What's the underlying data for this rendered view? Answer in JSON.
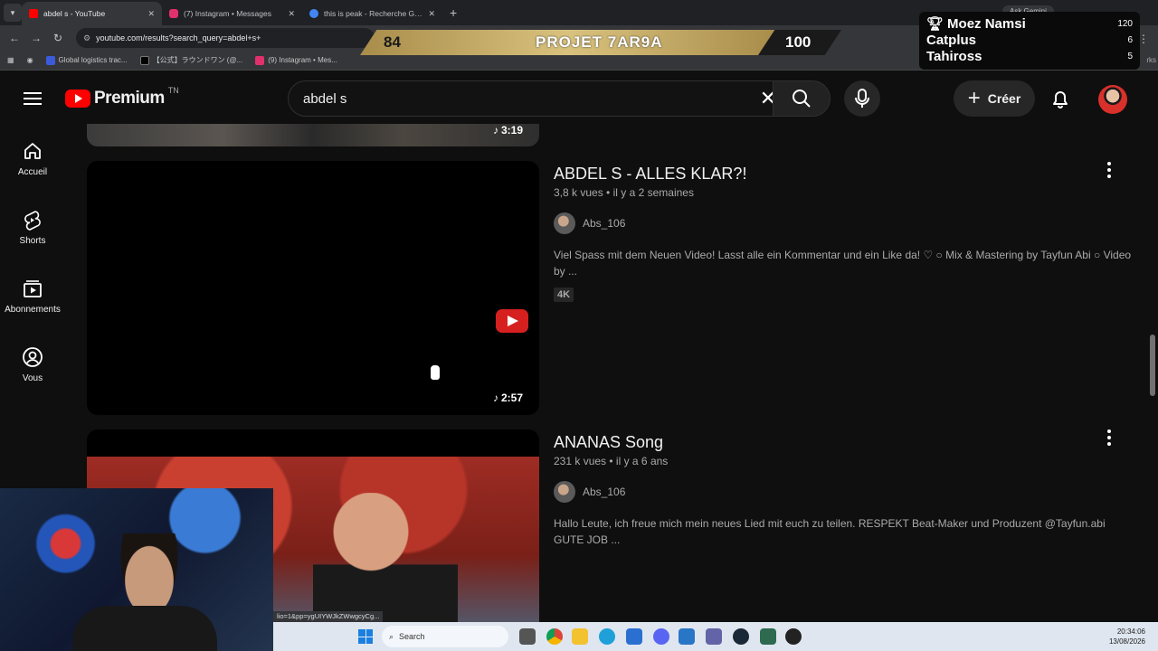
{
  "browser": {
    "tabs": [
      {
        "title": "abdel s - YouTube",
        "active": true,
        "favicon_color": "#ff0000"
      },
      {
        "title": "(7) Instagram • Messages",
        "active": false,
        "favicon_color": "#e1306c"
      },
      {
        "title": "this is peak - Recherche Google",
        "active": false,
        "favicon_color": "#4285f4"
      }
    ],
    "ask_label": "Ask Gemini",
    "url": "youtube.com/results?search_query=abdel+s+",
    "bookmarks": [
      "Global logistics trac...",
      "【公式】ラウンドワン (@...",
      "(9) Instagram • Mes..."
    ],
    "bookmarks_end": "rks"
  },
  "overlay": {
    "banner": {
      "left": "84",
      "title": "PROJET 7AR9A",
      "right": "100"
    },
    "leaderboard": [
      {
        "name": "Moez Namsi",
        "score": "120",
        "trophy": true
      },
      {
        "name": "Catplus",
        "score": "6"
      },
      {
        "name": "Tahiross",
        "score": "5"
      }
    ]
  },
  "header": {
    "logo_text": "Premium",
    "country": "TN",
    "search_value": "abdel s",
    "create_label": "Créer"
  },
  "sidebar": {
    "items": [
      {
        "label": "Accueil",
        "icon": "home-icon"
      },
      {
        "label": "Shorts",
        "icon": "shorts-icon"
      },
      {
        "label": "Abonnements",
        "icon": "subscriptions-icon"
      },
      {
        "label": "Vous",
        "icon": "you-icon"
      }
    ]
  },
  "results": [
    {
      "duration": "3:19"
    },
    {
      "title": "ABDEL S - ALLES KLAR?!",
      "views": "3,8 k vues",
      "age": "il y a 2 semaines",
      "channel": "Abs_106",
      "description": "Viel Spass mit dem Neuen Video! Lasst alle ein Kommentar und ein Like da! ♡ ○ Mix & Mastering by Tayfun Abi ○ Video by ...",
      "badge": "4K",
      "duration": "2:57"
    },
    {
      "title": "ANANAS Song",
      "views": "231 k vues",
      "age": "il y a 6 ans",
      "channel": "Abs_106",
      "description": "Hallo Leute, ich freue mich mein neues Lied mit euch zu teilen. RESPEKT Beat-Maker und Produzent @Tayfun.abi GUTE JOB ..."
    }
  ],
  "status_link": "lio=1&pp=ygUIYWJkZWwgcyCg...",
  "taskbar": {
    "search_label": "Search",
    "time": "20:34:06",
    "date": "13/08/2026"
  }
}
